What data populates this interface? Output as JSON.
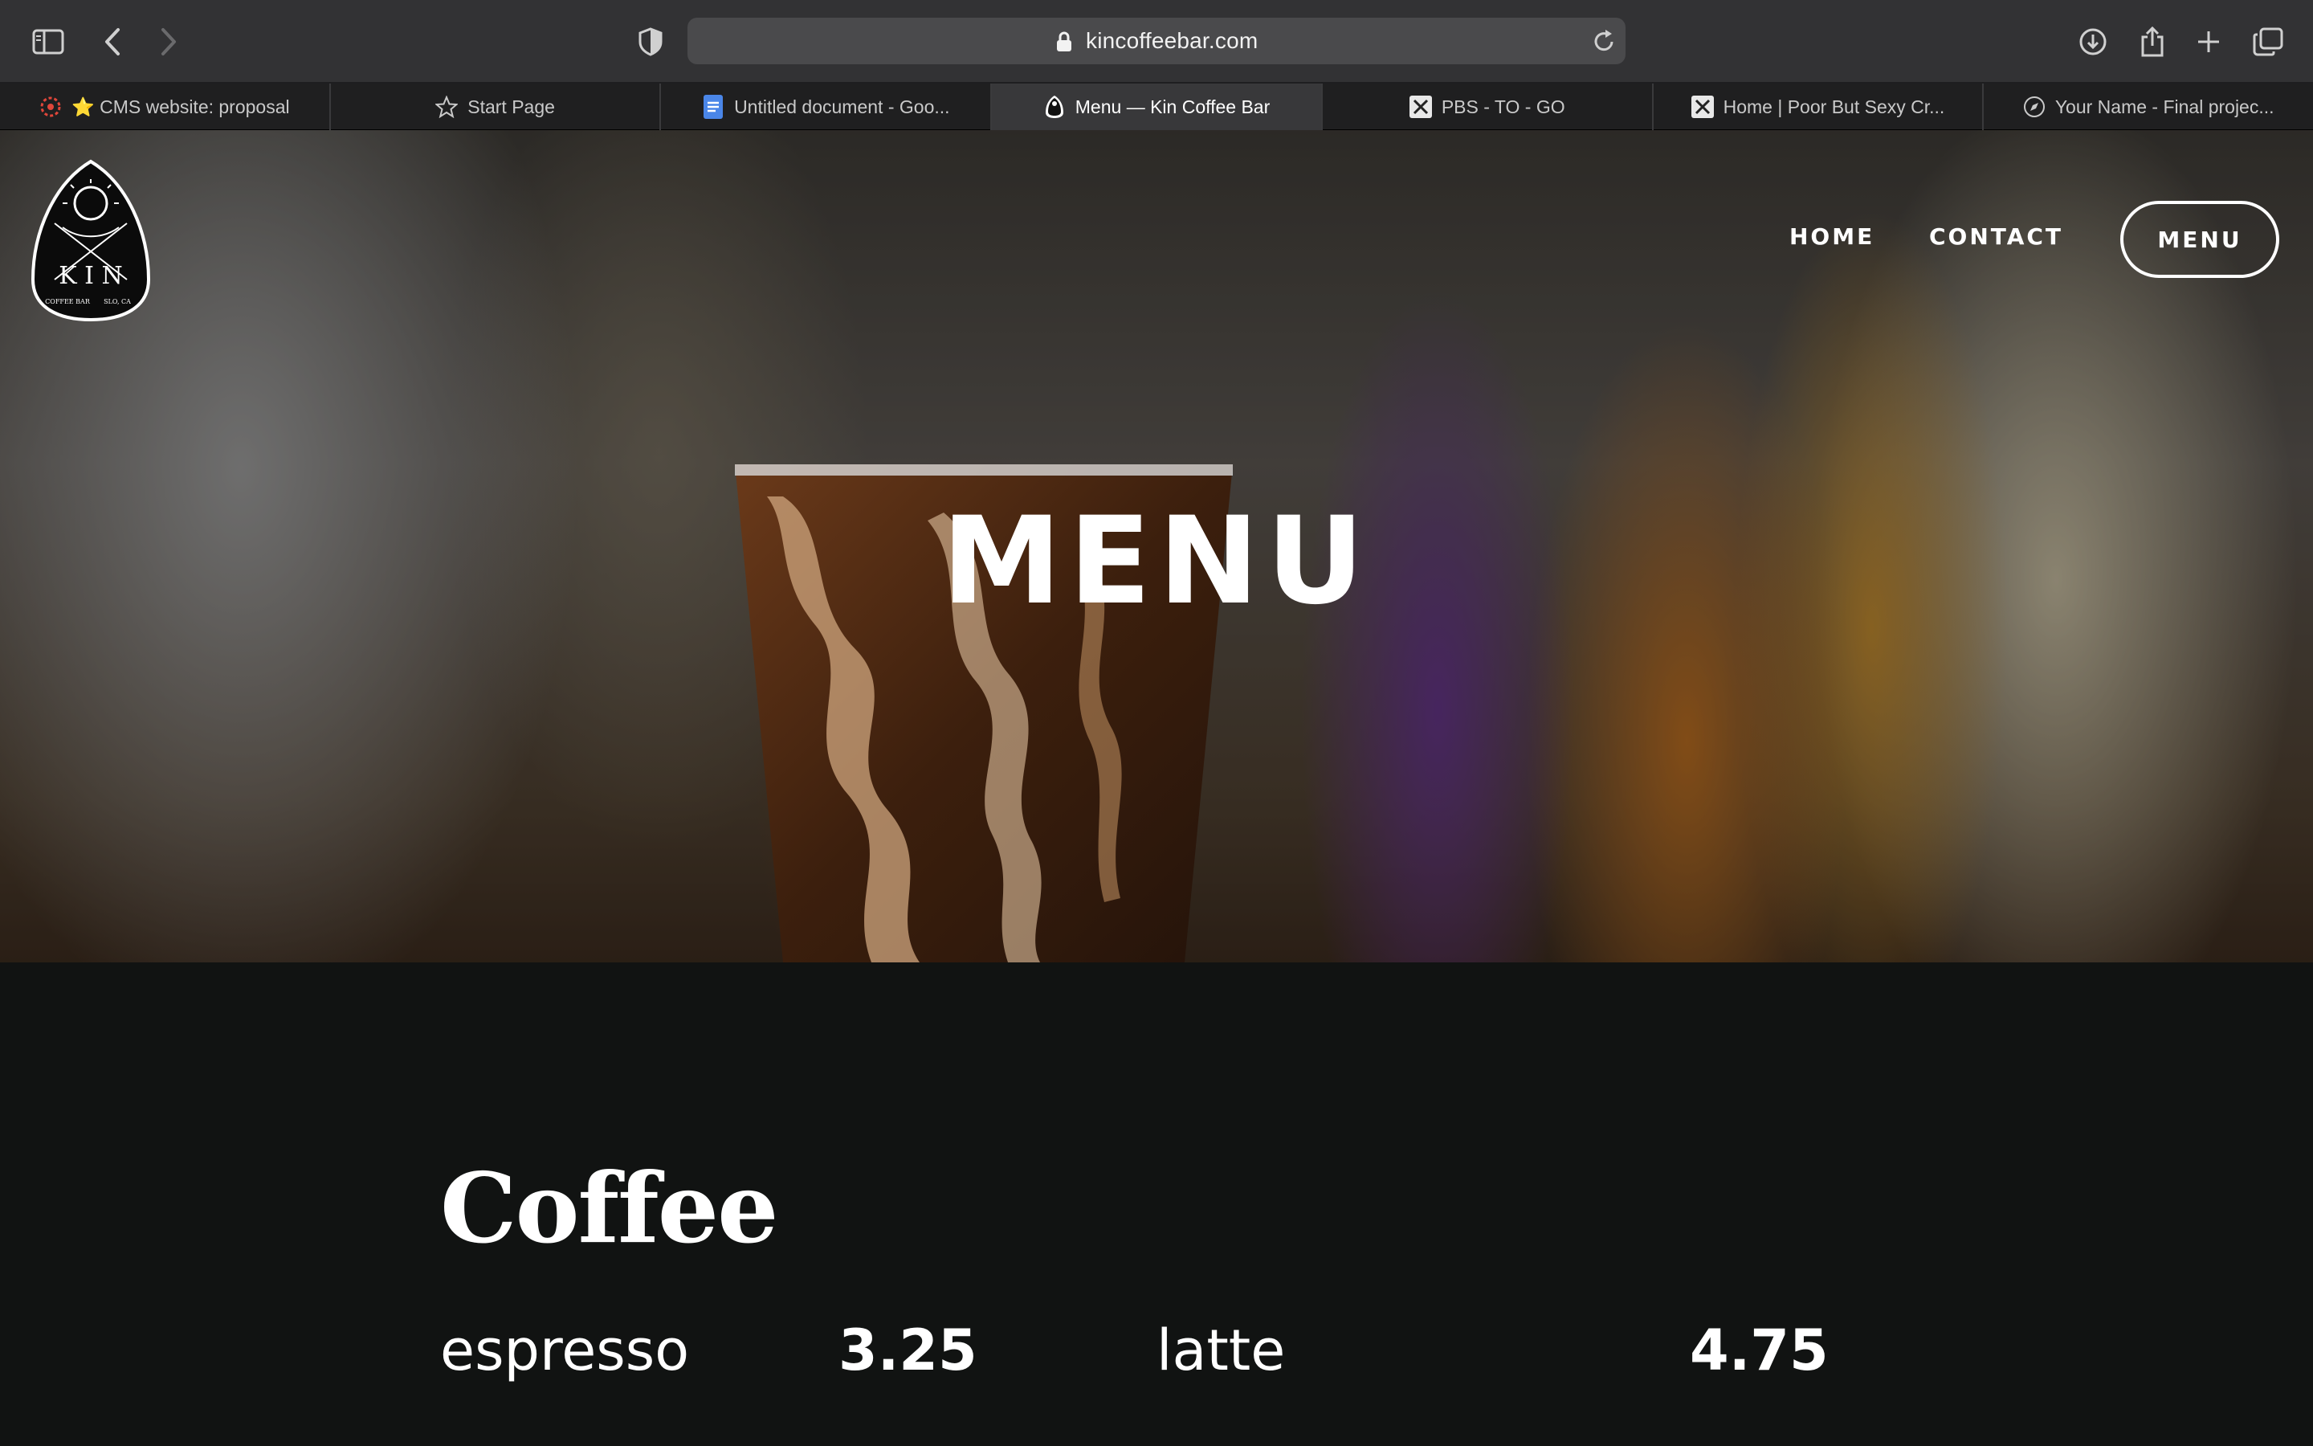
{
  "browser": {
    "url": "kincoffeebar.com",
    "tabs": [
      {
        "label": "⭐ CMS website: proposal",
        "icon": "sun-burst-icon",
        "active": false
      },
      {
        "label": "Start Page",
        "icon": "star-outline-icon",
        "active": false
      },
      {
        "label": "Untitled document - Goo...",
        "icon": "google-docs-icon",
        "active": false
      },
      {
        "label": "Menu — Kin Coffee Bar",
        "icon": "kin-logo-icon",
        "active": true
      },
      {
        "label": "PBS - TO - GO",
        "icon": "crossed-utensils-icon",
        "active": false
      },
      {
        "label": "Home | Poor But Sexy Cr...",
        "icon": "crossed-utensils-icon",
        "active": false
      },
      {
        "label": "Your Name - Final projec...",
        "icon": "compass-icon",
        "active": false
      }
    ]
  },
  "site": {
    "logo": {
      "letters": "K I N",
      "sub_left": "COFFEE BAR",
      "sub_right": "SLO, CA"
    },
    "nav": {
      "home": "HOME",
      "contact": "CONTACT",
      "menu": "MENU"
    },
    "hero_title": "MENU"
  },
  "menu": {
    "section_title": "Coffee",
    "items": [
      {
        "name": "espresso",
        "price": "3.25"
      },
      {
        "name": "latte",
        "price": "4.75"
      }
    ]
  }
}
